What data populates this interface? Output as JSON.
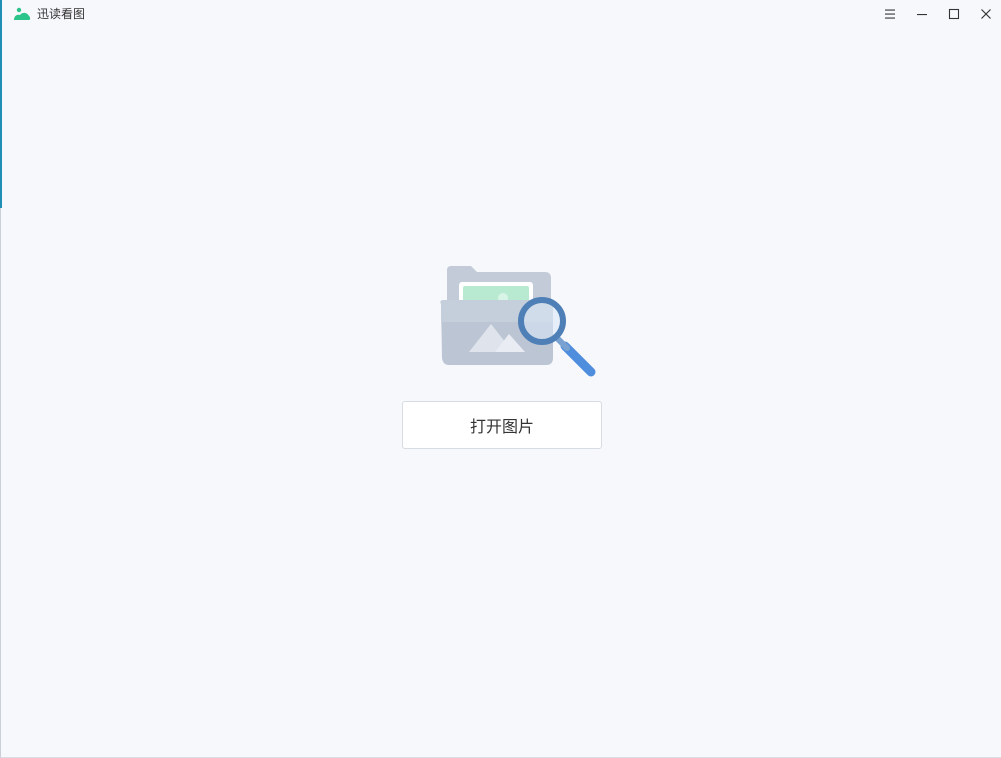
{
  "app": {
    "title": "迅读看图",
    "brand_color": "#2bc48a"
  },
  "titlebar": {
    "controls": [
      {
        "name": "menu",
        "icon": "menu-icon"
      },
      {
        "name": "minimize",
        "icon": "minimize-icon"
      },
      {
        "name": "maximize",
        "icon": "maximize-icon"
      },
      {
        "name": "close",
        "icon": "close-icon"
      }
    ]
  },
  "main": {
    "illustration": "folder-image-search-icon",
    "open_button_label": "打开图片"
  }
}
